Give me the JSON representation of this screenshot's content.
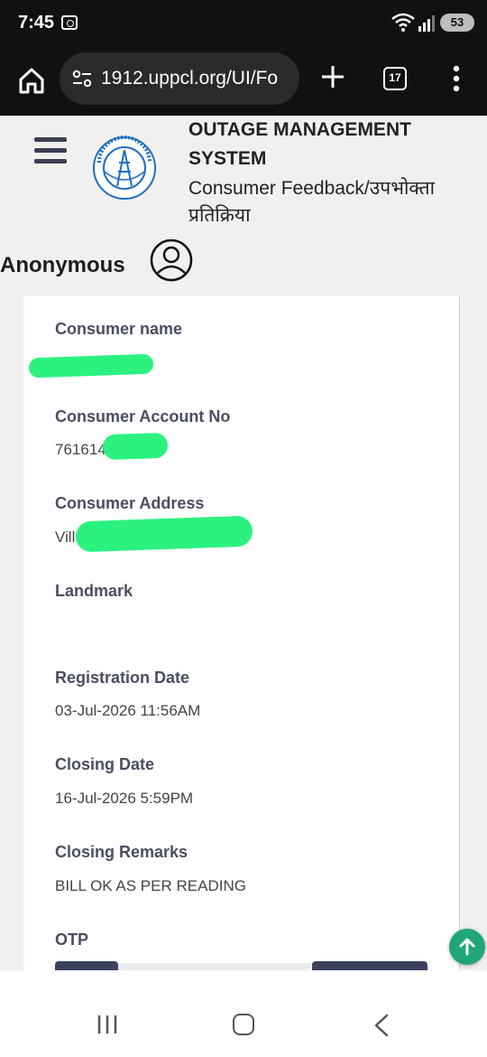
{
  "status_bar": {
    "time": "7:45",
    "battery": "53"
  },
  "browser": {
    "url": "1912.uppcl.org/UI/Fo",
    "tab_count": "17"
  },
  "header": {
    "title_line1": "OUTAGE MANAGEMENT",
    "title_line2": "SYSTEM",
    "subtitle": "Consumer Feedback/उपभोक्ता प्रतिक्रिया",
    "user_name": "Anonymous"
  },
  "fields": [
    {
      "label": "Consumer name",
      "value": ""
    },
    {
      "label": "Consumer Account No",
      "value": "761614"
    },
    {
      "label": "Consumer Address",
      "value": "Vill"
    },
    {
      "label": "Landmark",
      "value": ""
    },
    {
      "label": "Registration Date",
      "value": "03-Jul-2026 11:56AM"
    },
    {
      "label": "Closing Date",
      "value": "16-Jul-2026 5:59PM"
    },
    {
      "label": "Closing Remarks",
      "value": "BILL OK AS PER READING"
    },
    {
      "label": "OTP",
      "value": ""
    }
  ],
  "colors": {
    "accent": "#3c4160",
    "scroll_button": "#20a779",
    "redaction": "#2bf27f",
    "header_bg": "#f1f0ef"
  }
}
